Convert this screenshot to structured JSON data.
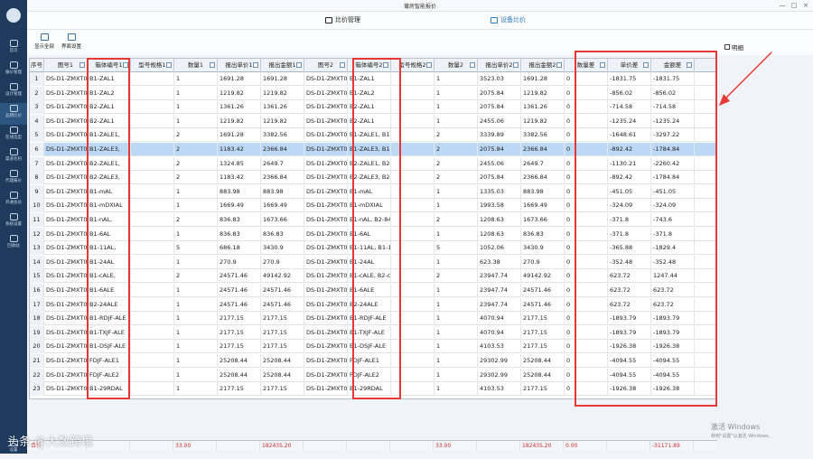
{
  "window": {
    "title": "莆房智能报价",
    "min": "—",
    "max": "□",
    "close": "×"
  },
  "sidebar": {
    "items": [
      "首页",
      "报价管理",
      "设计管理",
      "品牌比价",
      "在线选型",
      "渠道毛利",
      "代理报价",
      "开通会员",
      "系统设置",
      "回收站",
      "设置"
    ]
  },
  "tabs": {
    "compare": "比价管理",
    "device": "设备比价"
  },
  "toolbar": {
    "show_all": "显示全部",
    "interface": "界面设置",
    "detail_label": "明细"
  },
  "columns": [
    "序号",
    "图号1",
    "箱体编号1",
    "型号规格1",
    "数量1",
    "报出单价1",
    "报出金额1",
    "图号2",
    "箱体编号2",
    "型号规格2",
    "数量2",
    "报出单价2",
    "报出金额2",
    "数量差",
    "单价差",
    "金额差"
  ],
  "rows": [
    [
      "1",
      "DS-D1-ZMXT0",
      "B1-ZAL1",
      "",
      "1",
      "1691.28",
      "1691.28",
      "DS-D1-ZMXT0",
      "B1-ZAL1",
      "",
      "1",
      "3523.03",
      "1691.28",
      "0",
      "-1831.75",
      "-1831.75"
    ],
    [
      "2",
      "DS-D1-ZMXT0",
      "B1-ZAL2",
      "",
      "1",
      "1219.82",
      "1219.82",
      "DS-D1-ZMXT0",
      "B1-ZAL2",
      "",
      "1",
      "2075.84",
      "1219.82",
      "0",
      "-856.02",
      "-856.02"
    ],
    [
      "3",
      "DS-D1-ZMXT0",
      "B2-ZAL1",
      "",
      "1",
      "1361.26",
      "1361.26",
      "DS-D1-ZMXT0",
      "B2-ZAL1",
      "",
      "1",
      "2075.84",
      "1361.26",
      "0",
      "-714.58",
      "-714.58"
    ],
    [
      "4",
      "DS-D1-ZMXT0",
      "B2-ZAL1",
      "",
      "1",
      "1219.82",
      "1219.82",
      "DS-D1-ZMXT0",
      "B2-ZAL1",
      "",
      "1",
      "2455.06",
      "1219.82",
      "0",
      "-1235.24",
      "-1235.24"
    ],
    [
      "5",
      "DS-D1-ZMXT0",
      "B1-ZALE1,",
      "",
      "2",
      "1691.28",
      "3382.56",
      "DS-D1-ZMXT0",
      "B1-ZALE1,  B1-",
      "",
      "2",
      "3339.89",
      "3382.56",
      "0",
      "-1648.61",
      "-3297.22"
    ],
    [
      "6",
      "DS-D1-ZMXT0",
      "B1-ZALE3,",
      "",
      "2",
      "1183.42",
      "2366.84",
      "DS-D1-ZMXT0",
      "B1-ZALE3,  B1-",
      "",
      "2",
      "2075.84",
      "2366.84",
      "0",
      "-892.42",
      "-1784.84"
    ],
    [
      "7",
      "DS-D1-ZMXT0",
      "B2-ZALE1,",
      "",
      "2",
      "1324.85",
      "2649.7",
      "DS-D1-ZMXT0",
      "B2-ZALE1,  B2-",
      "",
      "2",
      "2455.06",
      "2649.7",
      "0",
      "-1130.21",
      "-2260.42"
    ],
    [
      "8",
      "DS-D1-ZMXT0",
      "B2-ZALE3,",
      "",
      "2",
      "1183.42",
      "2366.84",
      "DS-D1-ZMXT0",
      "B2-ZALE3,  B2-",
      "",
      "2",
      "2075.84",
      "2366.84",
      "0",
      "-892.42",
      "-1784.84"
    ],
    [
      "9",
      "DS-D1-ZMXT0",
      "B1-mAL",
      "",
      "1",
      "883.98",
      "883.98",
      "DS-D1-ZMXT0",
      "B1-mAL",
      "",
      "1",
      "1335.03",
      "883.98",
      "0",
      "-451.05",
      "-451.05"
    ],
    [
      "10",
      "DS-D1-ZMXT0",
      "B1-mDXIAL",
      "",
      "1",
      "1669.49",
      "1669.49",
      "DS-D1-ZMXT0",
      "B1-mDXIAL",
      "",
      "1",
      "1993.58",
      "1669.49",
      "0",
      "-324.09",
      "-324.09"
    ],
    [
      "11",
      "DS-D1-ZMXT0",
      "B1-nAL,",
      "",
      "2",
      "836.83",
      "1673.66",
      "DS-D1-ZMXT0",
      "B1-nAL,  B2-84",
      "",
      "2",
      "1208.63",
      "1673.66",
      "0",
      "-371.8",
      "-743.6"
    ],
    [
      "12",
      "DS-D1-ZMXT0",
      "B1-6AL",
      "",
      "1",
      "836.83",
      "836.83",
      "DS-D1-ZMXT0",
      "B1-6AL",
      "",
      "1",
      "1208.63",
      "836.83",
      "0",
      "-371.8",
      "-371.8"
    ],
    [
      "13",
      "DS-D1-ZMXT0",
      "B1-11AL,",
      "",
      "5",
      "686.18",
      "3430.9",
      "DS-D1-ZMXT0",
      "B1-11AL,  B1-1",
      "",
      "5",
      "1052.06",
      "3430.9",
      "0",
      "-365.88",
      "-1829.4"
    ],
    [
      "14",
      "DS-D1-ZMXT0",
      "B1-24AL",
      "",
      "1",
      "270.9",
      "270.9",
      "DS-D1-ZMXT0",
      "B1-24AL",
      "",
      "1",
      "623.38",
      "270.9",
      "0",
      "-352.48",
      "-352.48"
    ],
    [
      "15",
      "DS-D1-ZMXT0",
      "B1-cALE,",
      "",
      "2",
      "24571.46",
      "49142.92",
      "DS-D1-ZMXT0",
      "B1-cALE,  B2-c",
      "",
      "2",
      "23947.74",
      "49142.92",
      "0",
      "623.72",
      "1247.44"
    ],
    [
      "16",
      "DS-D1-ZMXT0",
      "B1-6ALE",
      "",
      "1",
      "24571.46",
      "24571.46",
      "DS-D1-ZMXT0",
      "B1-6ALE",
      "",
      "1",
      "23947.74",
      "24571.46",
      "0",
      "623.72",
      "623.72"
    ],
    [
      "17",
      "DS-D1-ZMXT0",
      "B2-24ALE",
      "",
      "1",
      "24571.46",
      "24571.46",
      "DS-D1-ZMXT0",
      "B2-24ALE",
      "",
      "1",
      "23947.74",
      "24571.46",
      "0",
      "623.72",
      "623.72"
    ],
    [
      "18",
      "DS-D1-ZMXT0",
      "B1-RDJF-ALE",
      "",
      "1",
      "2177.15",
      "2177.15",
      "DS-D1-ZMXT0",
      "B1-RDJF-ALE",
      "",
      "1",
      "4070.94",
      "2177.15",
      "0",
      "-1893.79",
      "-1893.79"
    ],
    [
      "19",
      "DS-D1-ZMXT0",
      "B1-TXJF-ALE",
      "",
      "1",
      "2177.15",
      "2177.15",
      "DS-D1-ZMXT0",
      "B1-TXJF-ALE",
      "",
      "1",
      "4070.94",
      "2177.15",
      "0",
      "-1893.79",
      "-1893.79"
    ],
    [
      "20",
      "DS-D1-ZMXT0",
      "B1-DSJF-ALE",
      "",
      "1",
      "2177.15",
      "2177.15",
      "DS-D1-ZMXT0",
      "B1-DSJF-ALE",
      "",
      "1",
      "4103.53",
      "2177.15",
      "0",
      "-1926.38",
      "-1926.38"
    ],
    [
      "21",
      "DS-D1-ZMXT0",
      "FDJF-ALE1",
      "",
      "1",
      "25208.44",
      "25208.44",
      "DS-D1-ZMXT0",
      "FDJF-ALE1",
      "",
      "1",
      "29302.99",
      "25208.44",
      "0",
      "-4094.55",
      "-4094.55"
    ],
    [
      "22",
      "DS-D1-ZMXT0",
      "FDJF-ALE2",
      "",
      "1",
      "25208.44",
      "25208.44",
      "DS-D1-ZMXT0",
      "FDJF-ALE2",
      "",
      "1",
      "29302.99",
      "25208.44",
      "0",
      "-4094.55",
      "-4094.55"
    ],
    [
      "23",
      "DS-D1-ZMXT0",
      "B1-29RDAL",
      "",
      "1",
      "2177.15",
      "2177.15",
      "DS-D1-ZMXT0",
      "B1-29RDAL",
      "",
      "1",
      "4103.53",
      "2177.15",
      "0",
      "-1926.38",
      "-1926.38"
    ]
  ],
  "selected_row": 6,
  "totals": [
    "合计",
    "",
    "",
    "",
    "33.00",
    "",
    "182435.20",
    "",
    "",
    "",
    "33.00",
    "",
    "182435.20",
    "0.00",
    "",
    "-31171.89"
  ],
  "watermark": "头条 @大数跨境",
  "activation": {
    "title": "激活 Windows",
    "sub": "转到\"设置\"以激活 Windows。"
  },
  "colors": {
    "sidebar": "#1e3a5c",
    "selected_row": "#bcd8f4",
    "highlight": "#e53935",
    "totals_text": "#d32f2f",
    "tab_active": "#2e7dbf"
  }
}
